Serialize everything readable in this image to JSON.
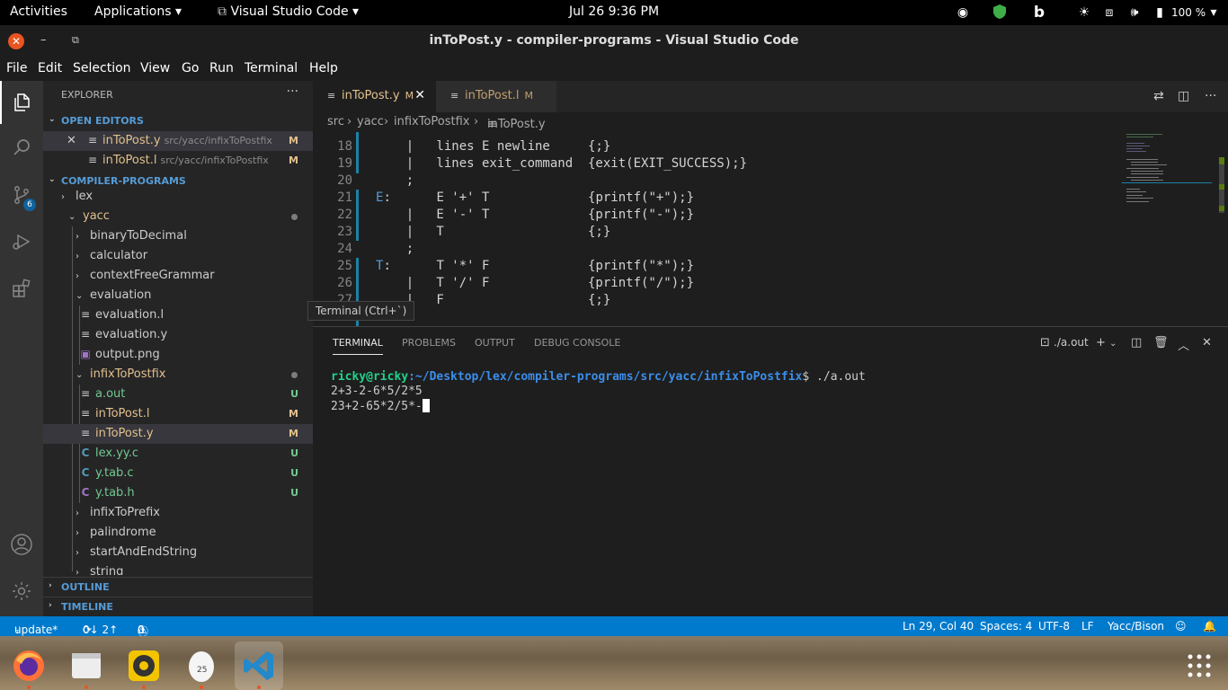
{
  "topbar": {
    "activities": "Activities",
    "applications": "Applications",
    "app_menu": "Visual Studio Code",
    "datetime": "Jul 26   9:36 PM",
    "battery": "100 %"
  },
  "window": {
    "title": "inToPost.y - compiler-programs - Visual Studio Code"
  },
  "menu": [
    "File",
    "Edit",
    "Selection",
    "View",
    "Go",
    "Run",
    "Terminal",
    "Help"
  ],
  "activity": {
    "scm_badge": "6"
  },
  "explorer": {
    "header": "EXPLORER",
    "open_editors": "OPEN EDITORS",
    "open_files": [
      {
        "name": "inToPost.y",
        "desc": "src/yacc/infixToPostfix",
        "status": "M"
      },
      {
        "name": "inToPost.l",
        "desc": "src/yacc/infixToPostfix",
        "status": "M"
      }
    ],
    "project": "COMPILER-PROGRAMS",
    "tree": {
      "lex": "lex",
      "yacc": "yacc",
      "binaryToDecimal": "binaryToDecimal",
      "calculator": "calculator",
      "contextFreeGrammar": "contextFreeGrammar",
      "evaluation": "evaluation",
      "evaluation_l": "evaluation.l",
      "evaluation_y": "evaluation.y",
      "output_png": "output.png",
      "infixToPostfix": "infixToPostfix",
      "a_out": "a.out",
      "a_out_status": "U",
      "inToPost_l": "inToPost.l",
      "inToPost_l_status": "M",
      "inToPost_y": "inToPost.y",
      "inToPost_y_status": "M",
      "lex_yy_c": "lex.yy.c",
      "lex_yy_c_status": "U",
      "y_tab_c": "y.tab.c",
      "y_tab_c_status": "U",
      "y_tab_h": "y.tab.h",
      "y_tab_h_status": "U",
      "infixToPrefix": "infixToPrefix",
      "palindrome": "palindrome",
      "startAndEndString": "startAndEndString",
      "string": "string"
    },
    "outline": "OUTLINE",
    "timeline": "TIMELINE"
  },
  "tabs": [
    {
      "name": "inToPost.y",
      "status": "M"
    },
    {
      "name": "inToPost.l",
      "status": "M"
    }
  ],
  "breadcrumb": [
    "src",
    "yacc",
    "infixToPostfix",
    "inToPost.y"
  ],
  "editor": {
    "lines": [
      {
        "n": "18",
        "text": "    |   lines E newline     {;}"
      },
      {
        "n": "19",
        "text": "    |   lines exit_command  {exit(EXIT_SUCCESS);}"
      },
      {
        "n": "20",
        "text": "    ;"
      },
      {
        "n": "21",
        "label": "E",
        "text": ":      E '+' T             {printf(\"+\");}"
      },
      {
        "n": "22",
        "text": "    |   E '-' T             {printf(\"-\");}"
      },
      {
        "n": "23",
        "text": "    |   T                   {;}"
      },
      {
        "n": "24",
        "text": "    ;"
      },
      {
        "n": "25",
        "label": "T",
        "text": ":      T '*' F             {printf(\"*\");}"
      },
      {
        "n": "26",
        "text": "    |   T '/' F             {printf(\"/\");}"
      },
      {
        "n": "27",
        "text": "    |   F                   {;}"
      }
    ]
  },
  "tooltip": "Terminal (Ctrl+`)",
  "panel": {
    "tabs": [
      "TERMINAL",
      "PROBLEMS",
      "OUTPUT",
      "DEBUG CONSOLE"
    ],
    "terminal_name": "./a.out",
    "prompt_user": "ricky@ricky",
    "prompt_path": ":~/Desktop/lex/compiler-programs/src/yacc/infixToPostfix",
    "command": "$ ./a.out",
    "line1": "2+3-2-6*5/2*5",
    "line2": "23+2-65*2/5*-"
  },
  "status": {
    "branch": "update*",
    "sync": "0↓ 2↑",
    "problems": "0",
    "warnings": "0",
    "position": "Ln 29, Col 40",
    "spaces": "Spaces: 4",
    "encoding": "UTF-8",
    "eol": "LF",
    "language": "Yacc/Bison"
  },
  "colors": {
    "accent": "#007acc",
    "modified": "#e2c08d",
    "untracked": "#73c991"
  }
}
